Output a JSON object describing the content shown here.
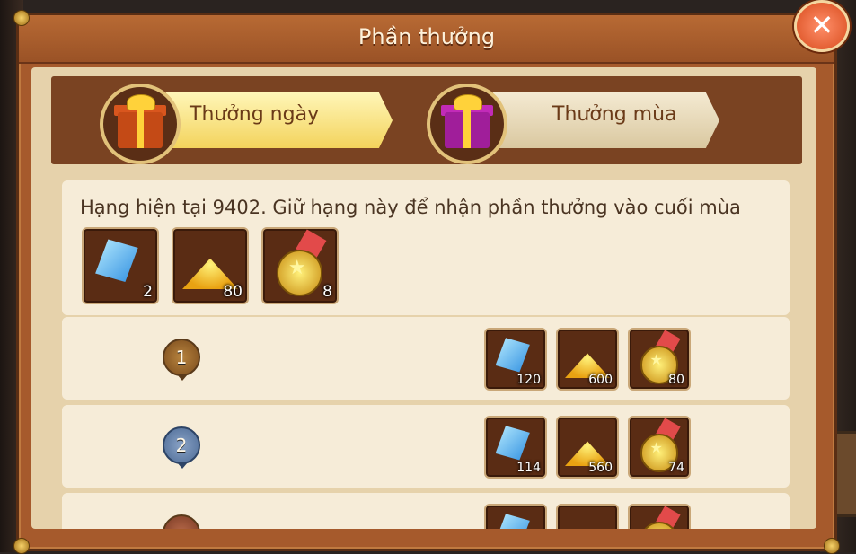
{
  "dialog": {
    "title": "Phần thưởng",
    "close_icon": "close-icon"
  },
  "tabs": [
    {
      "label": "Thưởng ngày",
      "icon": "gift-orange-icon",
      "active": true,
      "color": "#f3d35c"
    },
    {
      "label": "Thưởng mùa",
      "icon": "gift-purple-icon",
      "active": false,
      "color": "#dac8a0"
    }
  ],
  "current": {
    "text": "Hạng hiện tại 9402. Giữ hạng này để nhận phần thưởng vào cuối mùa",
    "rewards": [
      {
        "icon": "gem-icon",
        "count": "2"
      },
      {
        "icon": "gold-pile-icon",
        "count": "80"
      },
      {
        "icon": "medal-icon",
        "count": "8"
      }
    ]
  },
  "ranks": [
    {
      "rank": "1",
      "rewards": [
        {
          "icon": "gem-icon",
          "count": "120"
        },
        {
          "icon": "gold-pile-icon",
          "count": "600"
        },
        {
          "icon": "medal-icon",
          "count": "80"
        }
      ]
    },
    {
      "rank": "2",
      "rewards": [
        {
          "icon": "gem-icon",
          "count": "114"
        },
        {
          "icon": "gold-pile-icon",
          "count": "560"
        },
        {
          "icon": "medal-icon",
          "count": "74"
        }
      ]
    },
    {
      "rank": "",
      "rewards": [
        {
          "icon": "gem-icon",
          "count": ""
        },
        {
          "icon": "gold-pile-icon",
          "count": ""
        },
        {
          "icon": "medal-icon",
          "count": ""
        }
      ]
    }
  ]
}
